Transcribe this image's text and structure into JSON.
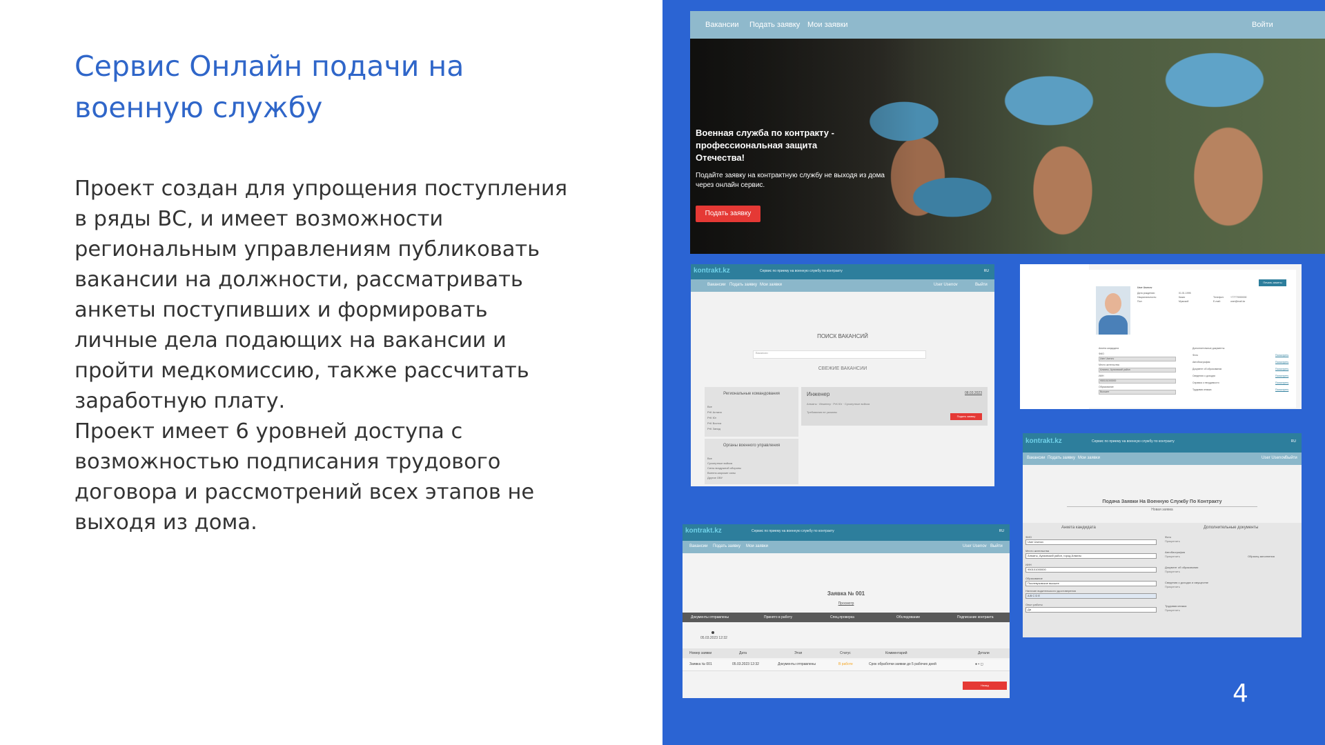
{
  "slide": {
    "title": "Сервис Онлайн подачи на военную службу",
    "paragraphs": [
      "Проект создан для упрощения поступления в ряды ВС, и имеет возможности региональным управлениям публиковать вакансии на должности, рассматривать анкеты поступивших и формировать личные дела подающих на вакансии и пройти медкомиссию, также рассчитать заработную плату.",
      "Проект имеет 6 уровней доступа с возможностью подписания трудового договора и рассмотрений всех этапов не выходя из дома."
    ],
    "page_number": "4"
  },
  "hero": {
    "nav": [
      "Вакансии",
      "Подать заявку",
      "Мои заявки"
    ],
    "login": "Войти",
    "headline": "Военная служба по контракту - профессиональная защита Отечества!",
    "subtext": "Подайте заявку на контрактную службу не выходя из дома через онлайн сервис.",
    "cta": "Подать заявку"
  },
  "site": {
    "logo": "kontrakt.kz",
    "tagline": "Сервис по приему на военную службу по контракту",
    "lang": "RU",
    "nav": [
      "Вакансии",
      "Подать заявку",
      "Мои заявки"
    ],
    "user": "User Usenov",
    "logout": "Выйти"
  },
  "vacancy_search": {
    "title": "ПОИСК ВАКАНСИЙ",
    "search_placeholder": "Вакансии",
    "fresh": "СВЕЖИЕ ВАКАНСИИ",
    "regional_title": "Региональные командования",
    "regional_options": [
      "Все",
      "РгК Астана",
      "РгК Юг",
      "РгК Восток",
      "РгК Запад"
    ],
    "branch_title": "Органы военного управления",
    "branch_options": [
      "Все",
      "Сухопутные войска",
      "Силы воздушной обороны",
      "Военно-морские силы",
      "Другие ОВУ"
    ],
    "card_title": "Инженер",
    "card_date": "08.03.2023",
    "card_meta": "Алматы · Инженер · РгК Юг · Сухопутные войска",
    "card_req": "Требования не указаны",
    "card_button": "Подать заявку"
  },
  "profile": {
    "print_button": "Печать анкеты",
    "name": "User Usenov",
    "birth_label": "Дата рождения:",
    "birth": "01.01.1995",
    "nation_label": "Национальность:",
    "nation": "Казах",
    "gender_label": "Пол:",
    "gender": "Мужской",
    "phone_label": "Телефон:",
    "phone": "+77770000000",
    "email_label": "E-mail:",
    "email": "user@mail.kz",
    "candidate_title": "Анкета кандидата",
    "docs_title": "Дополнительные документы",
    "fields": [
      "ФИО",
      "Место жительства",
      "ИИН",
      "Образование"
    ],
    "values": [
      "User Usenov",
      "Алматы, Ауэзовский район",
      "950101000000",
      "Высшее"
    ],
    "docs": [
      "Фото",
      "Автобиография",
      "Документ об образовании",
      "Сведения о доходах",
      "Справка о несудимости",
      "Трудовая книжка"
    ],
    "docs_link": "Посмотреть"
  },
  "application": {
    "title": "Заявка № 001",
    "view": "Просмотр",
    "steps": [
      "Документы отправлены",
      "Принято в работу",
      "Спец.проверка",
      "Обследование",
      "Подписание контракта"
    ],
    "timestamp": "05.03.2023 12:32",
    "columns": [
      "Номер заявки",
      "Дата",
      "Этап",
      "Статус",
      "Комментарий",
      "Детали"
    ],
    "row": [
      "Заявка № 001",
      "05.03.2023 12:32",
      "Документы отправлены",
      "В работе",
      "Срок обработки заявки до 5 рабочих дней"
    ],
    "button": "Назад",
    "status_color": "#f5a623"
  },
  "form": {
    "title": "Подача Заявки На Военную Службу По Контракту",
    "subtitle": "Новая заявка",
    "left_title": "Анкета кандидата",
    "right_title": "Дополнительные документы",
    "labels": [
      "ФИО",
      "Место жительства",
      "ИИН",
      "Образование",
      "Наличие водительского удостоверения",
      "Опыт работы"
    ],
    "values": [
      "User Usenov",
      "Алматы, Ауэзовский район, город Алматы",
      "950101000000",
      "Послевузовское высшее",
      "A B C D E",
      "Да"
    ],
    "docs": [
      "Фото",
      "Автобиография",
      "Документ об образовании",
      "Сведения о доходах и имуществе",
      "Трудовая книжка"
    ],
    "attach": "Прикрепить",
    "sample": "Образец заполнения"
  }
}
